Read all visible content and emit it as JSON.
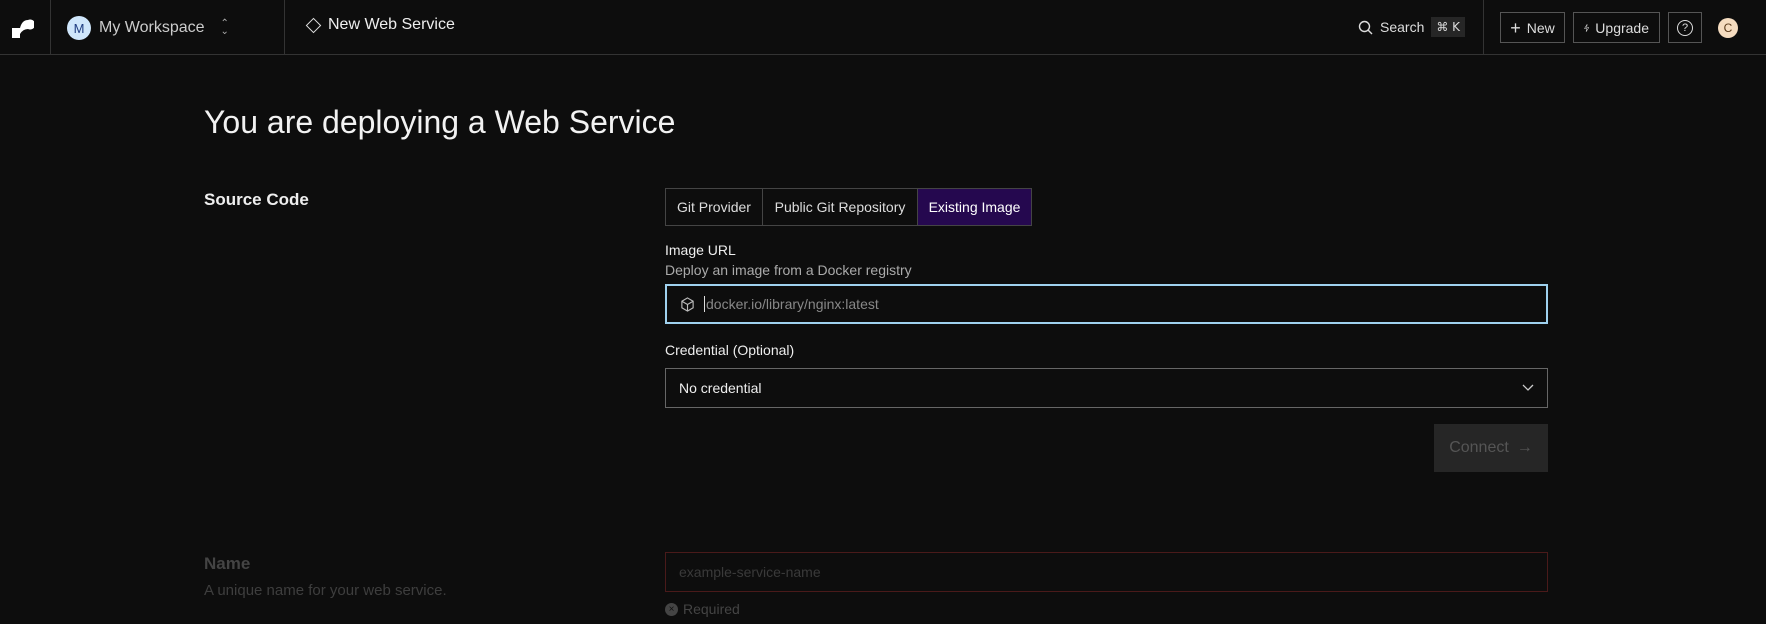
{
  "header": {
    "workspace_initial": "M",
    "workspace_name": "My Workspace",
    "page_title": "New Web Service",
    "search_label": "Search",
    "search_shortcut": "⌘ K",
    "new_label": "New",
    "upgrade_label": "Upgrade",
    "user_initial": "C"
  },
  "main": {
    "title": "You are deploying a Web Service",
    "source_code": {
      "label": "Source Code",
      "tabs": [
        {
          "label": "Git Provider",
          "active": false
        },
        {
          "label": "Public Git Repository",
          "active": false
        },
        {
          "label": "Existing Image",
          "active": true
        }
      ],
      "image_url_label": "Image URL",
      "image_url_help": "Deploy an image from a Docker registry",
      "image_url_placeholder": "docker.io/library/nginx:latest",
      "credential_label": "Credential (Optional)",
      "credential_value": "No credential",
      "connect_label": "Connect"
    },
    "name": {
      "label": "Name",
      "help": "A unique name for your web service.",
      "placeholder": "example-service-name",
      "error": "Required"
    }
  },
  "colors": {
    "accent_tab": "#25084f",
    "focus_border": "#9fd1ee",
    "error_border": "#4a1a1a"
  }
}
